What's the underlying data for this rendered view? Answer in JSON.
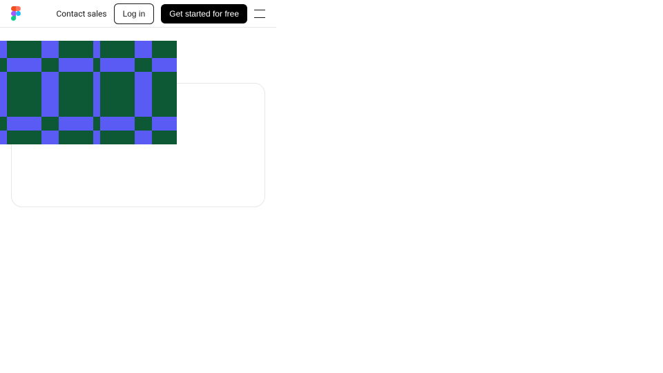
{
  "header": {
    "contact_label": "Contact sales",
    "login_label": "Log in",
    "get_started_label": "Get started for free"
  },
  "pattern": {
    "base_color": "#0d5936",
    "stripe_color": "#5a5af4"
  }
}
